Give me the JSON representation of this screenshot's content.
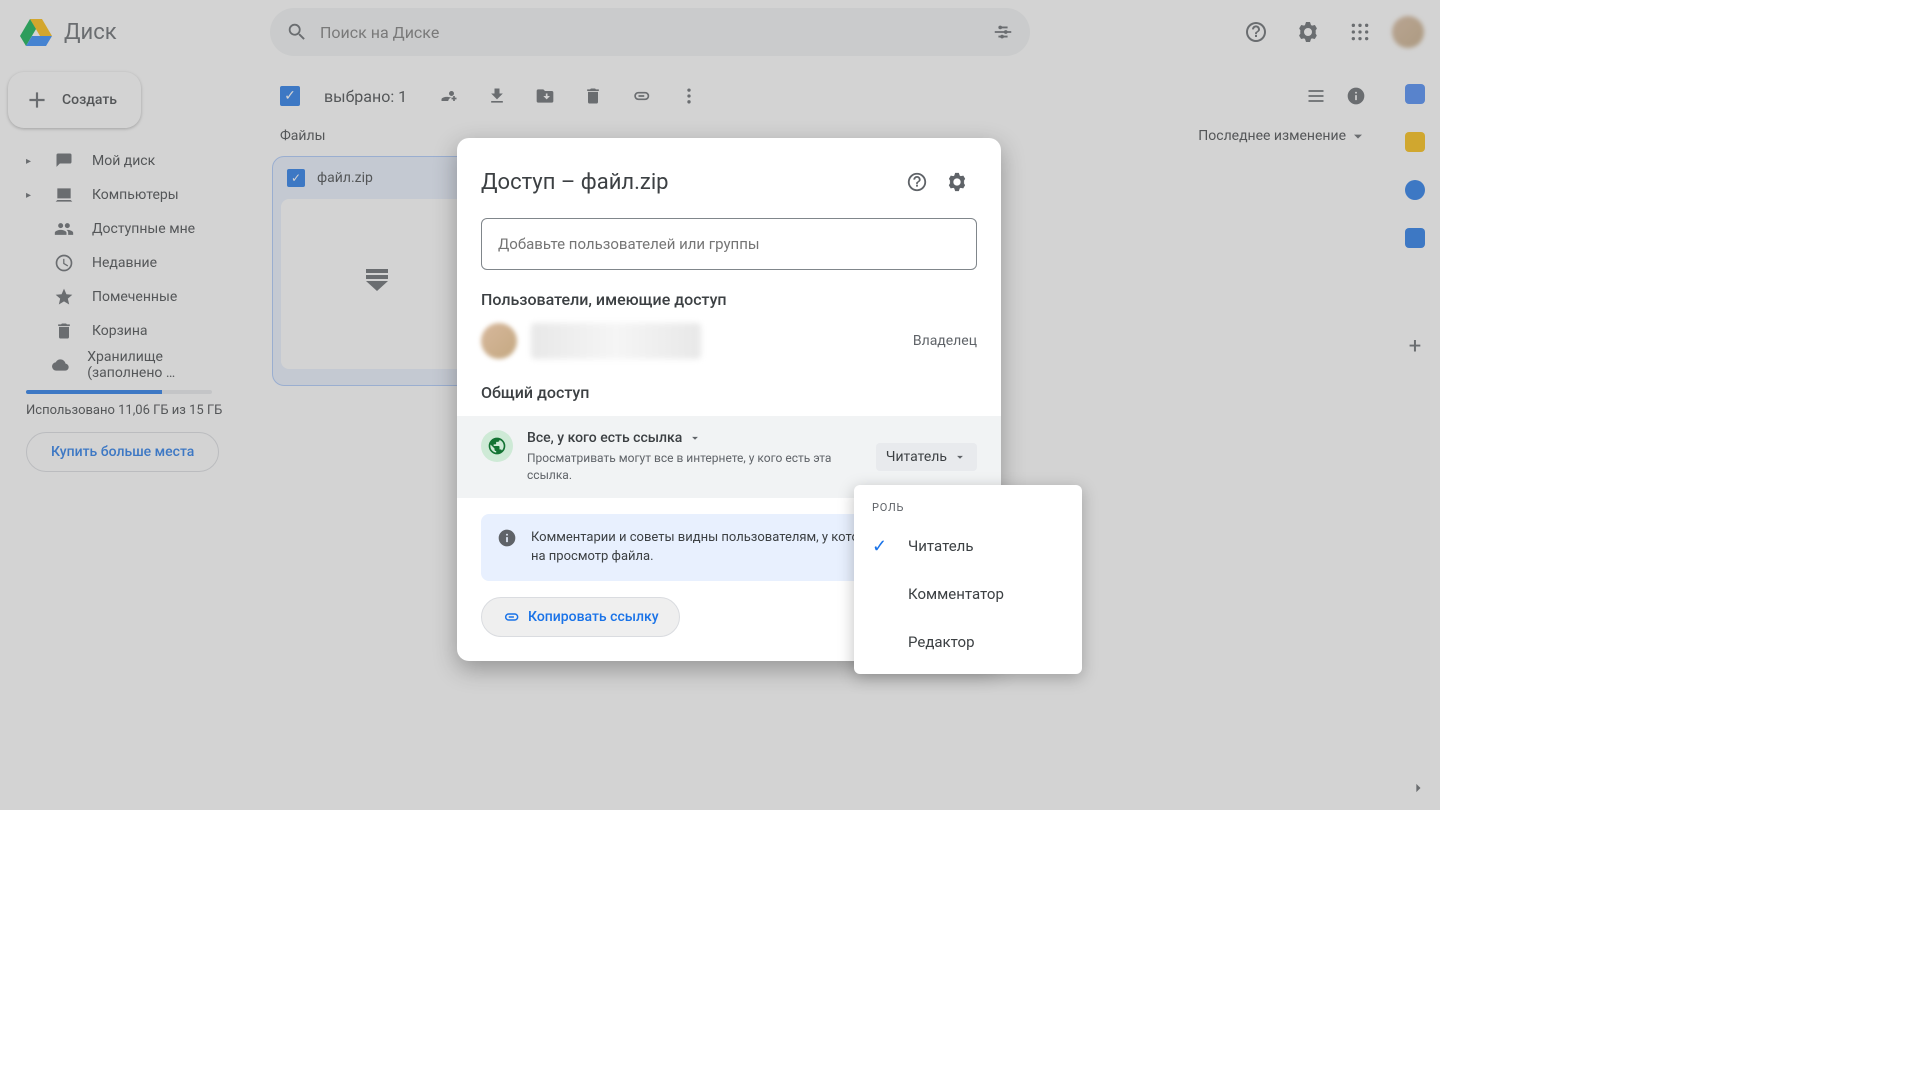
{
  "header": {
    "product": "Диск",
    "search_placeholder": "Поиск на Диске"
  },
  "sidebar": {
    "create": "Создать",
    "items": [
      {
        "label": "Мой диск",
        "caret": true
      },
      {
        "label": "Компьютеры",
        "caret": true
      },
      {
        "label": "Доступные мне",
        "caret": false
      },
      {
        "label": "Недавние",
        "caret": false
      },
      {
        "label": "Помеченные",
        "caret": false
      },
      {
        "label": "Корзина",
        "caret": false
      },
      {
        "label": "Хранилище (заполнено …",
        "caret": false
      }
    ],
    "storage_used": "Использовано 11,06 ГБ из 15 ГБ",
    "buy": "Купить больше места"
  },
  "toolbar": {
    "selected": "выбрано: 1"
  },
  "main": {
    "section": "Файлы",
    "sort": "Последнее изменение",
    "file_name": "файл.zip"
  },
  "dialog": {
    "title": "Доступ – файл.zip",
    "input_placeholder": "Добавьте пользователей или группы",
    "users_heading": "Пользователи, имеющие доступ",
    "owner": "Владелец",
    "general_heading": "Общий доступ",
    "link_scope": "Все, у кого есть ссылка",
    "link_desc": "Просматривать могут все в интернете, у кого есть эта ссылка.",
    "role_label": "Читатель",
    "info": "Комментарии и советы видны пользователям, у которых есть право на просмотр файла.",
    "copy": "Копировать ссылку"
  },
  "dropdown": {
    "heading": "РОЛЬ",
    "items": [
      "Читатель",
      "Комментатор",
      "Редактор"
    ],
    "selected": 0
  }
}
